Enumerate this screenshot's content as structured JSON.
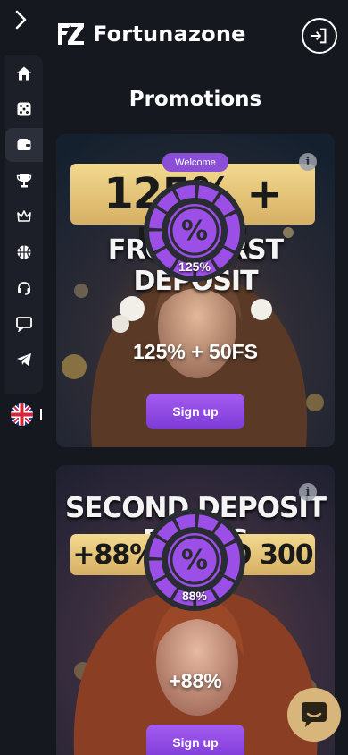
{
  "header": {
    "brand": "Fortunazone",
    "expand_icon": "chevron-right-icon",
    "login_icon": "login-icon"
  },
  "sidebar": {
    "items": [
      {
        "name": "home",
        "icon": "home-icon"
      },
      {
        "name": "casino",
        "icon": "dice-icon"
      },
      {
        "name": "promotions",
        "icon": "wallet-icon",
        "active": true
      },
      {
        "name": "tournaments",
        "icon": "trophy-icon"
      },
      {
        "name": "vip",
        "icon": "crown-icon"
      },
      {
        "name": "sports",
        "icon": "basketball-icon"
      },
      {
        "name": "support",
        "icon": "headset-icon"
      },
      {
        "name": "chat",
        "icon": "message-icon"
      },
      {
        "name": "telegram",
        "icon": "telegram-icon"
      }
    ],
    "language_icon": "uk-flag-icon"
  },
  "page": {
    "title": "Promotions"
  },
  "promotions": [
    {
      "badge": "Welcome",
      "banner_line1": "125% + 50FS",
      "banner_line2": "FROM FIRST DEPOSIT",
      "wheel_percent": "125%",
      "amount": "125% + 50FS",
      "button": "Sign up",
      "info": "i"
    },
    {
      "banner_line1": "SECOND DEPOSIT BONUS",
      "banner_line2": "+88% UP TO 300 EUR",
      "wheel_percent": "88%",
      "amount": "+88%",
      "button": "Sign up",
      "info": "i"
    }
  ],
  "chat_widget": {
    "icon": "chat-bubble-icon"
  },
  "colors": {
    "accent": "#8a4fd6",
    "background": "#16181f",
    "chat": "#d8b57a",
    "banner_gold": "#e9c97a"
  }
}
